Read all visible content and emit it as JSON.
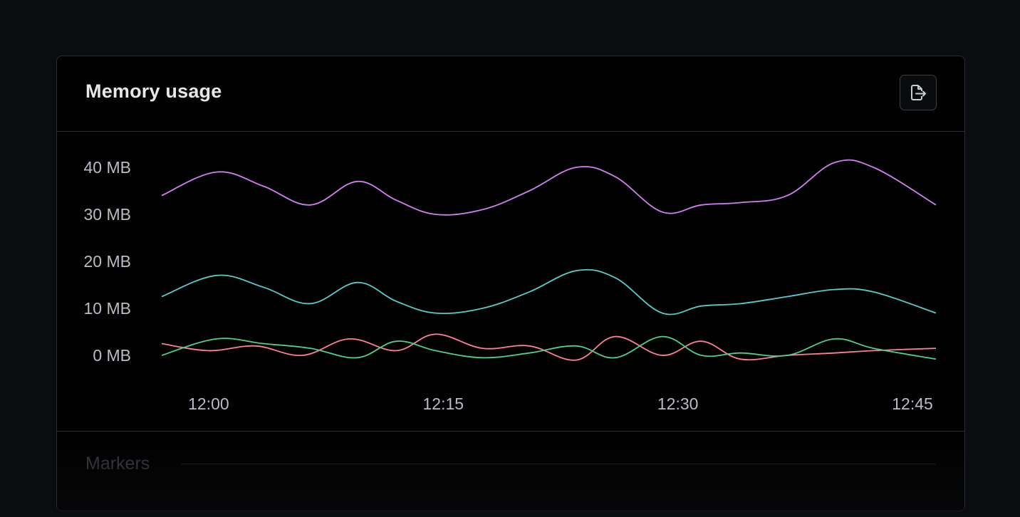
{
  "card": {
    "title": "Memory usage",
    "export_icon": "export-icon",
    "markers_label": "Markers"
  },
  "colors": {
    "purple": "#d27ff2",
    "cyan": "#5cc9c9",
    "pink": "#ff7f96",
    "green": "#4fcf88"
  },
  "chart_data": {
    "type": "line",
    "title": "Memory usage",
    "xlabel": "",
    "ylabel": "",
    "x_ticks": [
      "12:00",
      "12:15",
      "12:30",
      "12:45"
    ],
    "y_ticks": [
      "0 MB",
      "10 MB",
      "20 MB",
      "30 MB",
      "40 MB"
    ],
    "ylim": [
      0,
      40
    ],
    "x_range_minutes": [
      -3,
      46.5
    ],
    "grid": false,
    "legend": "none",
    "series": [
      {
        "color": "#d27ff2",
        "x": [
          -3,
          0.5,
          3.5,
          6.5,
          9.5,
          12,
          14.5,
          17.5,
          20.5,
          23.5,
          26,
          29,
          31.5,
          34,
          37,
          40,
          42.5,
          46.5
        ],
        "y": [
          34,
          39,
          36,
          32,
          37,
          33,
          30,
          31,
          35,
          40,
          38,
          30.5,
          32,
          32.5,
          34,
          41,
          40,
          32
        ]
      },
      {
        "color": "#5cc9c9",
        "x": [
          -3,
          0.5,
          3.5,
          6.5,
          9.5,
          12,
          14.5,
          17.5,
          20.5,
          23.5,
          26,
          29,
          31.5,
          34,
          37,
          40,
          42.5,
          46.5
        ],
        "y": [
          12.5,
          17,
          14.5,
          11,
          15.5,
          11.5,
          9,
          10,
          13.5,
          18,
          16.5,
          9,
          10.5,
          11,
          12.5,
          14,
          13.5,
          9
        ]
      },
      {
        "color": "#ff7f96",
        "x": [
          -3,
          0,
          3,
          6,
          9,
          12,
          14.5,
          17.5,
          20.5,
          23.5,
          26,
          29,
          31.5,
          34,
          37,
          40,
          42.5,
          46.5
        ],
        "y": [
          2.5,
          1,
          2,
          0,
          3.5,
          1,
          4.5,
          1.5,
          2,
          -1,
          4,
          0,
          3,
          -0.8,
          0,
          0.5,
          1,
          1.5
        ]
      },
      {
        "color": "#4fcf88",
        "x": [
          -3,
          0.5,
          3.5,
          6.5,
          9.5,
          12,
          14.5,
          17.5,
          20.5,
          23.5,
          26,
          29,
          31.5,
          34,
          37,
          40,
          42.5,
          46.5
        ],
        "y": [
          0,
          3.5,
          2.5,
          1.5,
          -0.5,
          3,
          1,
          -0.5,
          0.5,
          2,
          -0.5,
          4,
          0,
          0.5,
          0,
          3.5,
          1.5,
          -0.8
        ]
      }
    ]
  }
}
